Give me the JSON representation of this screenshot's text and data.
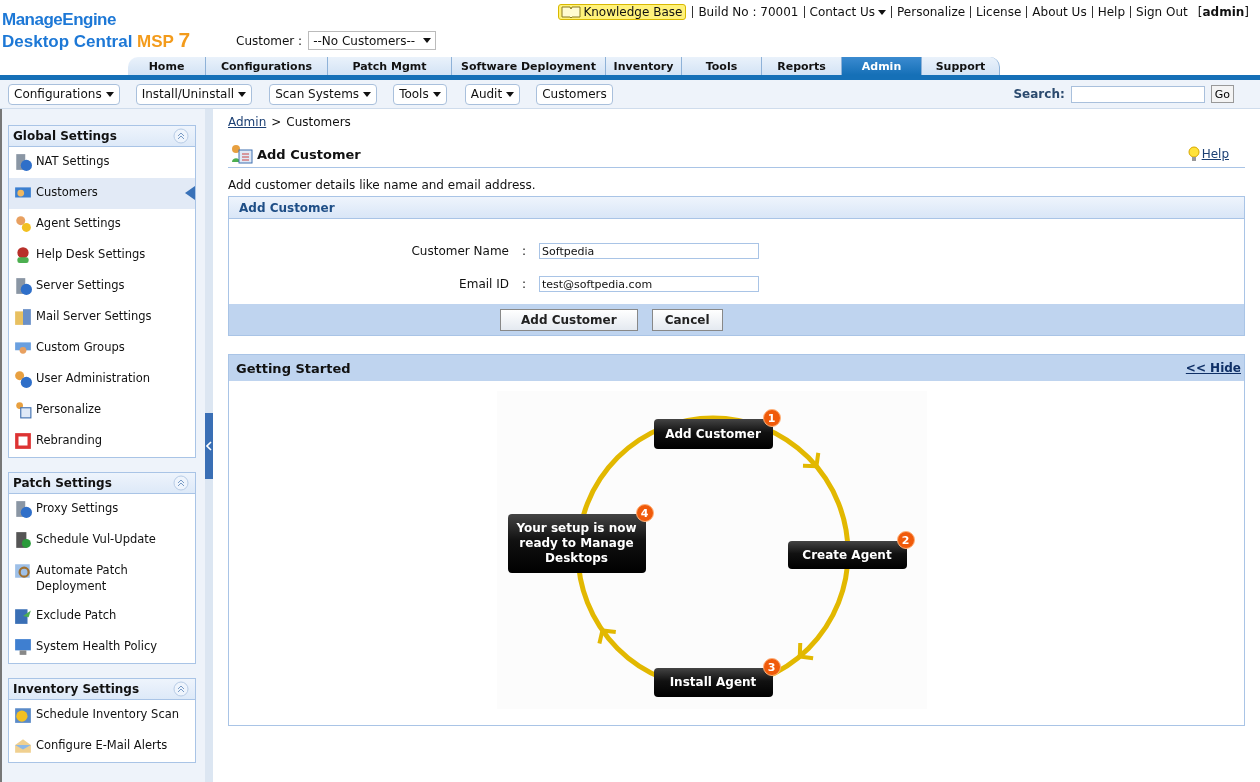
{
  "header": {
    "logo": {
      "brand": "ManageEngine",
      "product": "Desktop Central",
      "edition": "MSP",
      "version": "7"
    },
    "top_links": [
      {
        "kind": "badge",
        "label": "Knowledge Base"
      },
      {
        "kind": "text",
        "label": "Build No : 70001"
      },
      {
        "kind": "dropdown",
        "label": "Contact Us"
      },
      {
        "kind": "link",
        "label": "Personalize"
      },
      {
        "kind": "link",
        "label": "License"
      },
      {
        "kind": "link",
        "label": "About Us"
      },
      {
        "kind": "link",
        "label": "Help"
      },
      {
        "kind": "link",
        "label": "Sign Out"
      },
      {
        "kind": "user",
        "label": "[**admin**]"
      }
    ],
    "customer_select": {
      "label": "Customer :",
      "value": "--No Customers--"
    }
  },
  "tabs": [
    {
      "label": "Home",
      "selected": false
    },
    {
      "label": "Configurations",
      "selected": false
    },
    {
      "label": "Patch Mgmt",
      "selected": false
    },
    {
      "label": "Software Deployment",
      "selected": false
    },
    {
      "label": "Inventory",
      "selected": false
    },
    {
      "label": "Tools",
      "selected": false
    },
    {
      "label": "Reports",
      "selected": false
    },
    {
      "label": "Admin",
      "selected": true
    },
    {
      "label": "Support",
      "selected": false
    }
  ],
  "toolbar": {
    "menus": [
      {
        "label": "Configurations",
        "dropdown": true
      },
      {
        "label": "Install/Uninstall",
        "dropdown": true
      },
      {
        "label": "Scan Systems",
        "dropdown": true
      },
      {
        "label": "Tools",
        "dropdown": true
      },
      {
        "label": "Audit",
        "dropdown": true
      },
      {
        "label": "Customers",
        "dropdown": false
      }
    ],
    "search": {
      "label": "Search:",
      "button": "Go"
    }
  },
  "sidebar": {
    "sections": [
      {
        "title": "Global Settings",
        "items": [
          {
            "label": "NAT Settings",
            "selected": false
          },
          {
            "label": "Customers",
            "selected": true
          },
          {
            "label": "Agent Settings",
            "selected": false
          },
          {
            "label": "Help Desk Settings",
            "selected": false
          },
          {
            "label": "Server Settings",
            "selected": false
          },
          {
            "label": "Mail Server Settings",
            "selected": false
          },
          {
            "label": "Custom Groups",
            "selected": false
          },
          {
            "label": "User Administration",
            "selected": false
          },
          {
            "label": "Personalize",
            "selected": false
          },
          {
            "label": "Rebranding",
            "selected": false
          }
        ]
      },
      {
        "title": "Patch Settings",
        "items": [
          {
            "label": "Proxy Settings",
            "selected": false
          },
          {
            "label": "Schedule Vul-Update",
            "selected": false
          },
          {
            "label": "Automate Patch Deployment",
            "selected": false
          },
          {
            "label": "Exclude Patch",
            "selected": false
          },
          {
            "label": "System Health Policy",
            "selected": false
          }
        ]
      },
      {
        "title": "Inventory Settings",
        "items": [
          {
            "label": "Schedule Inventory Scan",
            "selected": false
          },
          {
            "label": "Configure E-Mail Alerts",
            "selected": false
          }
        ]
      }
    ]
  },
  "main": {
    "breadcrumb": {
      "link": "Admin",
      "separator": ">",
      "current": "Customers"
    },
    "page_title": "Add Customer",
    "help_link": "Help",
    "description": "Add customer details like name and email address.",
    "form": {
      "title": "Add Customer",
      "colon": ":",
      "fields": [
        {
          "label": "Customer Name",
          "value": "Softpedia"
        },
        {
          "label": "Email ID",
          "value": "test@softpedia.com"
        }
      ],
      "buttons": [
        "Add Customer",
        "Cancel"
      ]
    },
    "getting_started": {
      "title": "Getting Started",
      "hide_link": "<< Hide",
      "steps": [
        {
          "number": "1",
          "label": "Add Customer"
        },
        {
          "number": "2",
          "label": "Create Agent"
        },
        {
          "number": "3",
          "label": "Install Agent"
        },
        {
          "number": "4",
          "label": "Your setup is now ready to Manage Desktops"
        }
      ]
    }
  }
}
